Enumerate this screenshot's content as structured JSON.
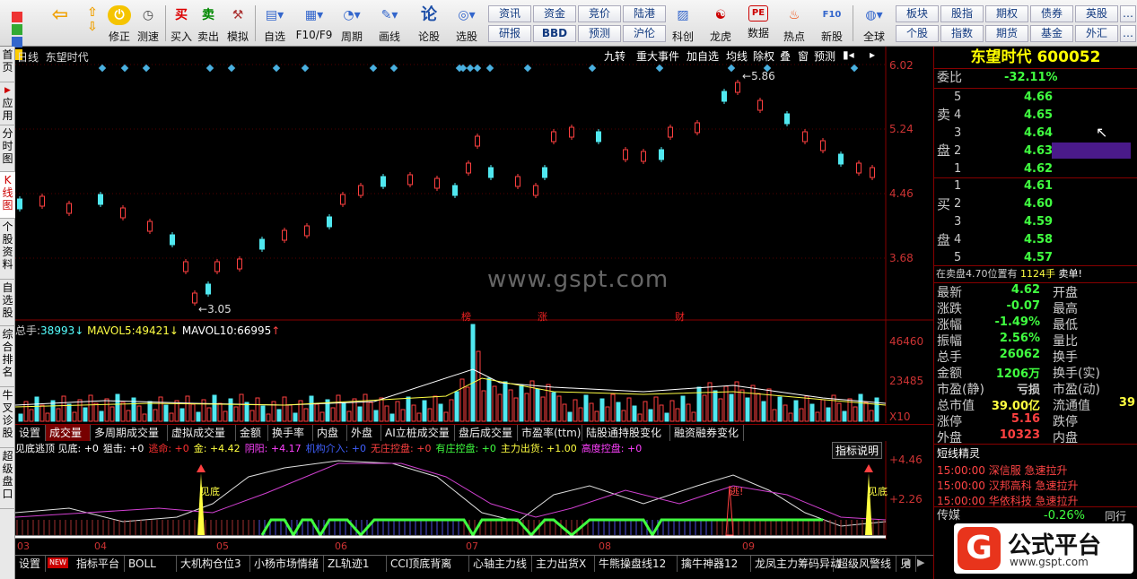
{
  "toolbar": {
    "groups": [
      {
        "label": "修正"
      },
      {
        "label": "测速"
      },
      {
        "label": "买入"
      },
      {
        "label": "卖出"
      },
      {
        "label": "模拟"
      },
      {
        "label": "自选"
      },
      {
        "label": "F10/F9"
      },
      {
        "label": "周期"
      },
      {
        "label": "画线"
      },
      {
        "label": "论股"
      },
      {
        "label": "选股"
      },
      {
        "label": "科创"
      },
      {
        "label": "龙虎"
      },
      {
        "label": "数据"
      },
      {
        "label": "热点"
      },
      {
        "label": "新股"
      },
      {
        "label": "全球"
      }
    ],
    "small_top": [
      "资讯",
      "资金",
      "竞价",
      "陆港",
      "板块",
      "股指",
      "期权",
      "债券",
      "英股"
    ],
    "small_bottom": [
      "研报",
      "BBD",
      "预测",
      "沪伦",
      "个股",
      "指数",
      "期货",
      "基金",
      "外汇"
    ],
    "icons": {
      "buy": "买",
      "sell": "卖",
      "n1": "论",
      "pe": "PE",
      "f10": "F10"
    },
    "colors": {
      "accent": "#c00000"
    }
  },
  "sidebar": {
    "items": [
      {
        "label": "首页",
        "active": false
      },
      {
        "label": "应用",
        "active": false
      },
      {
        "label": "分时图",
        "active": false
      },
      {
        "label": "K线图",
        "active": true
      },
      {
        "label": "个股资料",
        "active": false
      },
      {
        "label": "自选股",
        "active": false
      },
      {
        "label": "综合排名",
        "active": false
      },
      {
        "label": "牛叉诊股",
        "active": false
      },
      {
        "label": "超级盘口",
        "active": false
      }
    ]
  },
  "kline": {
    "period": "日线",
    "stock": "东望时代",
    "menu": [
      "九转",
      "重大事件",
      "加自选",
      "均线",
      "除权",
      "叠",
      "窗",
      "预测"
    ],
    "price_axis": [
      "6.02",
      "5.24",
      "4.46",
      "3.68"
    ],
    "high_label": "5.86",
    "low_label": "3.05",
    "markers": [
      "榜",
      "涨",
      "财"
    ],
    "watermark": "www.gspt.com"
  },
  "volume": {
    "label_total": "总手:",
    "total": "38993",
    "mavol5_label": "MAVOL5:",
    "mavol5": "49421",
    "mavol10_label": "MAVOL10:",
    "mavol10": "66995",
    "axis": [
      "46460",
      "23485",
      "X10"
    ]
  },
  "tabs1": [
    "设置",
    "成交量",
    "多周期成交量",
    "虚拟成交量",
    "金额",
    "换手率",
    "内盘",
    "外盘",
    "AI立桩成交量",
    "盘后成交量",
    "市盈率(ttm)",
    "陆股通持股变化",
    "融资融券变化"
  ],
  "indicator": {
    "items": [
      {
        "text": "见底逃顶 见底: +0",
        "color": "#ffffff"
      },
      {
        "text": "狙击: +0",
        "color": "#ffffff"
      },
      {
        "text": "逃命: +0",
        "color": "#ff3030"
      },
      {
        "text": "金: +4.42",
        "color": "#ffff40"
      },
      {
        "text": "阴阳: +4.17",
        "color": "#ff40ff"
      },
      {
        "text": "机构介入: +0",
        "color": "#4060ff"
      },
      {
        "text": "无庄控盘: +0",
        "color": "#ff4040"
      },
      {
        "text": "有庄控盘: +0",
        "color": "#40ff40"
      },
      {
        "text": "主力出货: +1.00",
        "color": "#ffff40"
      },
      {
        "text": "高度控盘: +0",
        "color": "#ff40ff"
      }
    ],
    "explain": "指标说明",
    "axis": [
      "+4.46",
      "+2.26"
    ],
    "signals": [
      "见底",
      "逃!",
      "见底"
    ],
    "months": [
      "03",
      "04",
      "05",
      "06",
      "07",
      "08",
      "09"
    ]
  },
  "bottom_tabs": [
    "设置",
    "指标平台",
    "BOLL",
    "大机构仓位3",
    "小杨市场情绪",
    "ZL轨迹1",
    "CCI顶底背离",
    "心轴主力线",
    "主力出货X",
    "牛熊操盘线12",
    "擒牛神器12",
    "龙凤主力筹码异动",
    "超级风警线",
    "见"
  ],
  "bottom_new": "NEW",
  "quote": {
    "name": "东望时代",
    "code": "600052",
    "weibi_label": "委比",
    "weibi": "-32.11%",
    "sell_label": [
      "卖",
      "盘"
    ],
    "buy_label": [
      "买",
      "盘"
    ],
    "sell": [
      {
        "n": "5",
        "p": "4.66"
      },
      {
        "n": "4",
        "p": "4.65"
      },
      {
        "n": "3",
        "p": "4.64"
      },
      {
        "n": "2",
        "p": "4.63"
      },
      {
        "n": "1",
        "p": "4.62"
      }
    ],
    "buy": [
      {
        "n": "1",
        "p": "4.61"
      },
      {
        "n": "2",
        "p": "4.60"
      },
      {
        "n": "3",
        "p": "4.59"
      },
      {
        "n": "4",
        "p": "4.58"
      },
      {
        "n": "5",
        "p": "4.57"
      }
    ],
    "notice": "在卖盘4.70位置有",
    "notice_vol": "1124手",
    "notice_tail": "卖单!",
    "stats": [
      {
        "l": "最新",
        "v": "4.62",
        "c": "#40ff40",
        "r": "开盘",
        "rv": ""
      },
      {
        "l": "涨跌",
        "v": "-0.07",
        "c": "#40ff40",
        "r": "最高",
        "rv": ""
      },
      {
        "l": "涨幅",
        "v": "-1.49%",
        "c": "#40ff40",
        "r": "最低",
        "rv": ""
      },
      {
        "l": "振幅",
        "v": "2.56%",
        "c": "#40ff40",
        "r": "量比",
        "rv": ""
      },
      {
        "l": "总手",
        "v": "26062",
        "c": "#40ff40",
        "r": "换手",
        "rv": ""
      },
      {
        "l": "金额",
        "v": "1206万",
        "c": "#40ff40",
        "r": "换手(实)",
        "rv": ""
      },
      {
        "l": "市盈(静)",
        "v": "亏损",
        "c": "#ccc",
        "r": "市盈(动)",
        "rv": ""
      },
      {
        "l": "总市值",
        "v": "39.00亿",
        "c": "#ffff40",
        "r": "流通值",
        "rv": "39"
      },
      {
        "l": "涨停",
        "v": "5.16",
        "c": "#ff4040",
        "r": "跌停",
        "rv": ""
      },
      {
        "l": "外盘",
        "v": "10323",
        "c": "#ff4040",
        "r": "内盘",
        "rv": ""
      }
    ],
    "short_title": "短线精灵",
    "short": [
      {
        "t": "15:00:00",
        "n": "深信服",
        "e": "急速拉升"
      },
      {
        "t": "15:00:00",
        "n": "汉邦高科",
        "e": "急速拉升"
      },
      {
        "t": "15:00:00",
        "n": "华依科技",
        "e": "急速拉升"
      }
    ],
    "sector": "传媒",
    "sector_chg": "-0.26%",
    "sector_tail": "同行",
    "logo_text": "公式平台",
    "logo_url": "www.gspt.com",
    "logo_g": "G"
  }
}
